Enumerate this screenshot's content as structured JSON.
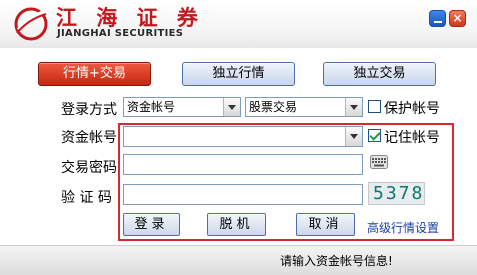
{
  "header": {
    "brand_cn": "江 海 证 券",
    "brand_en": "JIANGHAI SECURITIES",
    "close_glyph": "×"
  },
  "tabs": [
    {
      "label": "行情+交易",
      "active": true
    },
    {
      "label": "独立行情",
      "active": false
    },
    {
      "label": "独立交易",
      "active": false
    }
  ],
  "login": {
    "login_method_label": "登录方式",
    "account_type_value": "资金帐号",
    "trade_type_value": "股票交易",
    "protect_account_label": "保护帐号",
    "protect_account_checked": false,
    "account_label": "资金帐号",
    "account_value": "",
    "remember_account_label": "记住帐号",
    "remember_account_checked": true,
    "password_label": "交易密码",
    "password_value": "",
    "captcha_label": "验 证 码",
    "captcha_value": "",
    "captcha_code": "5378"
  },
  "actions": {
    "login_label": "登录",
    "offline_label": "脱机",
    "cancel_label": "取消",
    "advanced_link": "高级行情设置"
  },
  "status": {
    "message": "请输入资金帐号信息!"
  },
  "colors": {
    "brand_red": "#c4181d",
    "frame_red": "#d9282f",
    "tab_active": "#d9321a",
    "link_blue": "#1a3ea8"
  },
  "icons": {
    "logo": "jianghai-logo",
    "keyboard": "keyboard-icon",
    "minimize": "minimize-icon",
    "close": "close-icon"
  }
}
